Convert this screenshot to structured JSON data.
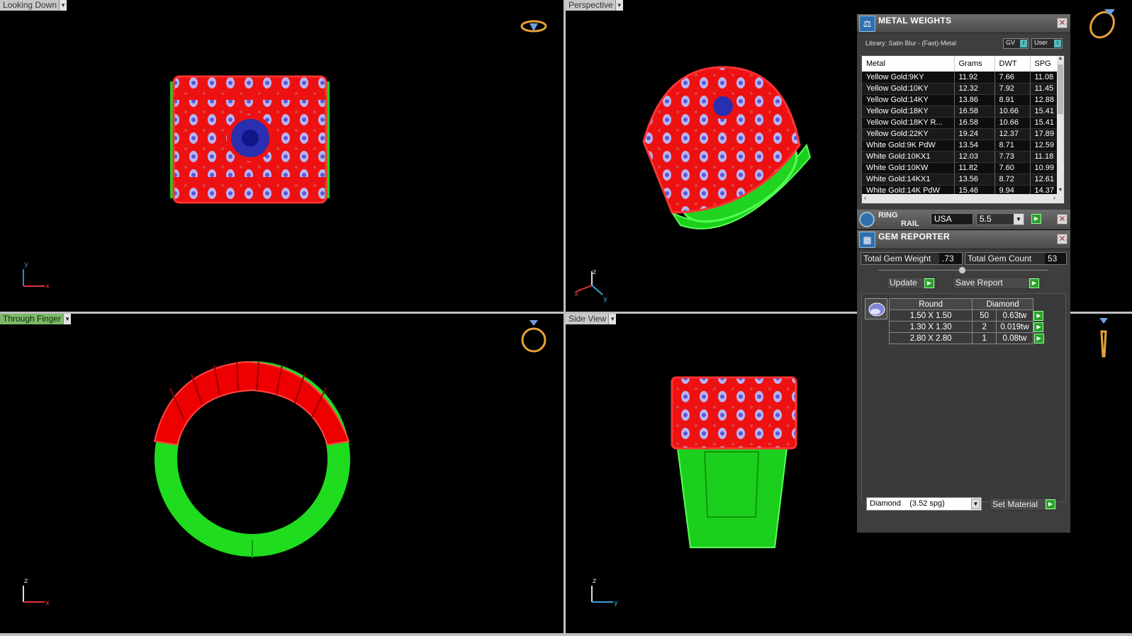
{
  "viewports": {
    "top_left": {
      "label": "Looking Down"
    },
    "top_right": {
      "label": "Perspective"
    },
    "bottom_left": {
      "label": "Through Finger"
    },
    "bottom_right": {
      "label": "Side View"
    }
  },
  "axes": {
    "top_left": {
      "a1": "y",
      "a2": "x"
    },
    "top_right": {
      "a1": "z",
      "a2": "y",
      "a3": "x"
    },
    "bottom_left": {
      "a1": "z",
      "a2": "x"
    },
    "bottom_right": {
      "a1": "z",
      "a2": "y"
    }
  },
  "metal_weights": {
    "title": "METAL WEIGHTS",
    "library": "Library: Satin Blur - (Fast)-Metal",
    "gv_label": "GV",
    "user_label": "User",
    "columns": [
      "Metal",
      "Grams",
      "DWT",
      "SPG"
    ],
    "rows": [
      [
        "Yellow Gold:9KY",
        "11.92",
        "7.66",
        "11.08"
      ],
      [
        "Yellow Gold:10KY",
        "12.32",
        "7.92",
        "11.45"
      ],
      [
        "Yellow Gold:14KY",
        "13.86",
        "8.91",
        "12.88"
      ],
      [
        "Yellow Gold:18KY",
        "16.58",
        "10.66",
        "15.41"
      ],
      [
        "Yellow Gold:18KY R...",
        "16.58",
        "10.66",
        "15.41"
      ],
      [
        "Yellow Gold:22KY",
        "19.24",
        "12.37",
        "17.89"
      ],
      [
        "White Gold:9K PdW",
        "13.54",
        "8.71",
        "12.59"
      ],
      [
        "White Gold:10KX1",
        "12.03",
        "7.73",
        "11.18"
      ],
      [
        "White Gold:10KW",
        "11.82",
        "7.60",
        "10.99"
      ],
      [
        "White Gold:14KX1",
        "13.56",
        "8.72",
        "12.61"
      ],
      [
        "White Gold:14K PdW",
        "15.46",
        "9.94",
        "14.37"
      ]
    ]
  },
  "ring_rail": {
    "title_line1": "RING",
    "title_line2": "RAIL",
    "standard": "USA",
    "size": "5.5"
  },
  "gem_reporter": {
    "title": "GEM REPORTER",
    "total_weight_label": "Total Gem Weight",
    "total_weight_value": ".73",
    "total_count_label": "Total Gem Count",
    "total_count_value": "53",
    "update_label": "Update",
    "save_report_label": "Save Report",
    "col_shape": "Round",
    "col_material": "Diamond",
    "rows": [
      [
        "1.50 X 1.50",
        "50",
        "0.63tw"
      ],
      [
        "1.30 X 1.30",
        "2",
        "0.019tw"
      ],
      [
        "2.80 X 2.80",
        "1",
        "0.08tw"
      ]
    ],
    "material_select": "Diamond    (3.52 spg)",
    "set_material_label": "Set Material"
  }
}
